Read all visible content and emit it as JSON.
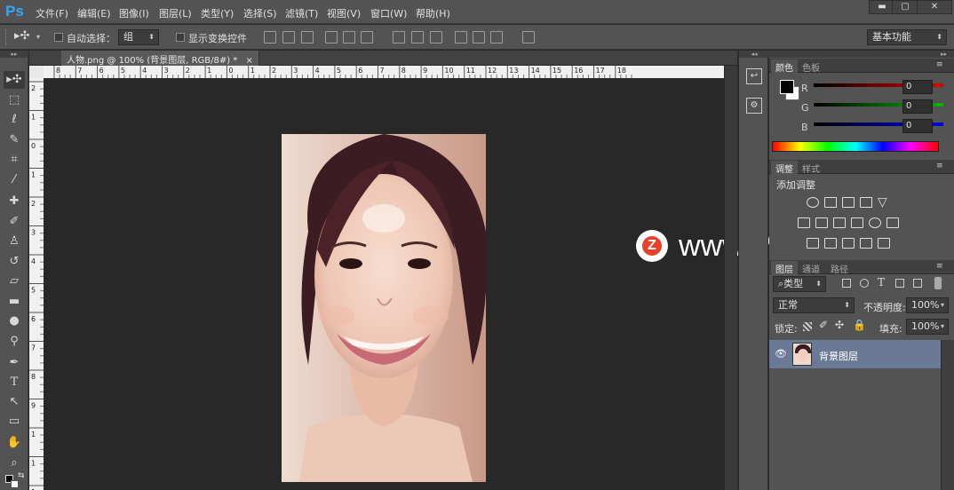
{
  "app": {
    "logo": "Ps"
  },
  "menu": [
    "文件(F)",
    "编辑(E)",
    "图像(I)",
    "图层(L)",
    "类型(Y)",
    "选择(S)",
    "滤镜(T)",
    "视图(V)",
    "窗口(W)",
    "帮助(H)"
  ],
  "window_buttons": {
    "minimize": "▬",
    "restore": "▢",
    "close": "✕"
  },
  "options": {
    "auto_select_label": "自动选择：",
    "auto_select_value": "组",
    "show_transform_label": "显示变换控件",
    "workspace": "基本功能"
  },
  "document": {
    "tab_title": "人物.png @ 100% (背景图层, RGB/8#) *",
    "tab_close": "×",
    "ruler_h_ticks": [
      "8",
      "7",
      "6",
      "5",
      "4",
      "3",
      "2",
      "1",
      "0",
      "1",
      "2",
      "3",
      "4",
      "5",
      "6",
      "7",
      "8",
      "9",
      "10",
      "11",
      "12",
      "13",
      "14",
      "15",
      "16",
      "17",
      "18"
    ],
    "ruler_v_ticks": [
      "2",
      "1",
      "0",
      "1",
      "2",
      "3",
      "4",
      "5",
      "6",
      "7",
      "8",
      "9",
      "1",
      "1",
      "1"
    ]
  },
  "color_panel": {
    "tabs": [
      "颜色",
      "色板"
    ],
    "channels": [
      {
        "name": "R",
        "value": "0",
        "color": "#e00000"
      },
      {
        "name": "G",
        "value": "0",
        "color": "#00b400"
      },
      {
        "name": "B",
        "value": "0",
        "color": "#0000e0"
      }
    ]
  },
  "adjust_panel": {
    "tabs": [
      "调整",
      "样式"
    ],
    "title": "添加调整"
  },
  "layers_panel": {
    "tabs": [
      "图层",
      "通道",
      "路径"
    ],
    "filter_label": "类型",
    "blend_mode": "正常",
    "opacity_label": "不透明度:",
    "opacity_value": "100%",
    "lock_label": "锁定:",
    "fill_label": "填充:",
    "fill_value": "100%",
    "layers": [
      {
        "name": "背景图层",
        "visible": true
      }
    ]
  },
  "watermark": {
    "logo": "Z",
    "text": "www.MacZ.com"
  },
  "colors": {
    "accent": "#31a8ff",
    "bg": "#535353",
    "selected_layer": "#6a7a96"
  }
}
